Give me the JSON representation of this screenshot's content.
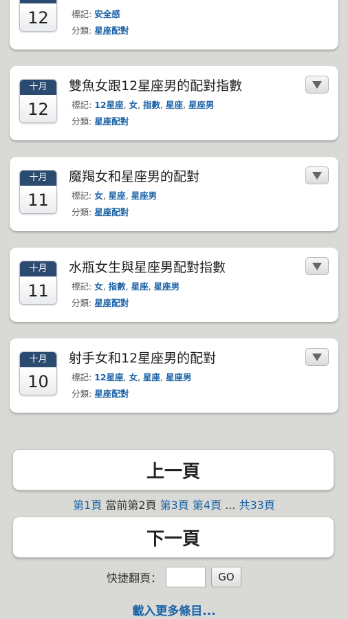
{
  "labels": {
    "tags": "標記:",
    "category": "分類:"
  },
  "articles": [
    {
      "month": "十月",
      "day": "12",
      "title": "",
      "tags": [
        "安全感"
      ],
      "category": "星座配對"
    },
    {
      "month": "十月",
      "day": "12",
      "title": "雙魚女跟12星座男的配對指數",
      "tags": [
        "12星座",
        "女",
        "指數",
        "星座",
        "星座男"
      ],
      "category": "星座配對"
    },
    {
      "month": "十月",
      "day": "11",
      "title": "魔羯女和星座男的配對",
      "tags": [
        "女",
        "星座",
        "星座男"
      ],
      "category": "星座配對"
    },
    {
      "month": "十月",
      "day": "11",
      "title": "水瓶女生與星座男配對指數",
      "tags": [
        "女",
        "指數",
        "星座",
        "星座男"
      ],
      "category": "星座配對"
    },
    {
      "month": "十月",
      "day": "10",
      "title": "射手女和12星座男的配對",
      "tags": [
        "12星座",
        "女",
        "星座",
        "星座男"
      ],
      "category": "星座配對"
    }
  ],
  "prev_button": "上一頁",
  "next_button": "下一頁",
  "pager": {
    "page1": "第1頁",
    "current": "當前第2頁",
    "page3": "第3頁",
    "page4": "第4頁",
    "ellipsis": "...",
    "total": "共33頁"
  },
  "jump": {
    "label": "快捷翻頁：",
    "input_value": "",
    "go_label": "GO"
  },
  "load_more": "載入更多條目..."
}
